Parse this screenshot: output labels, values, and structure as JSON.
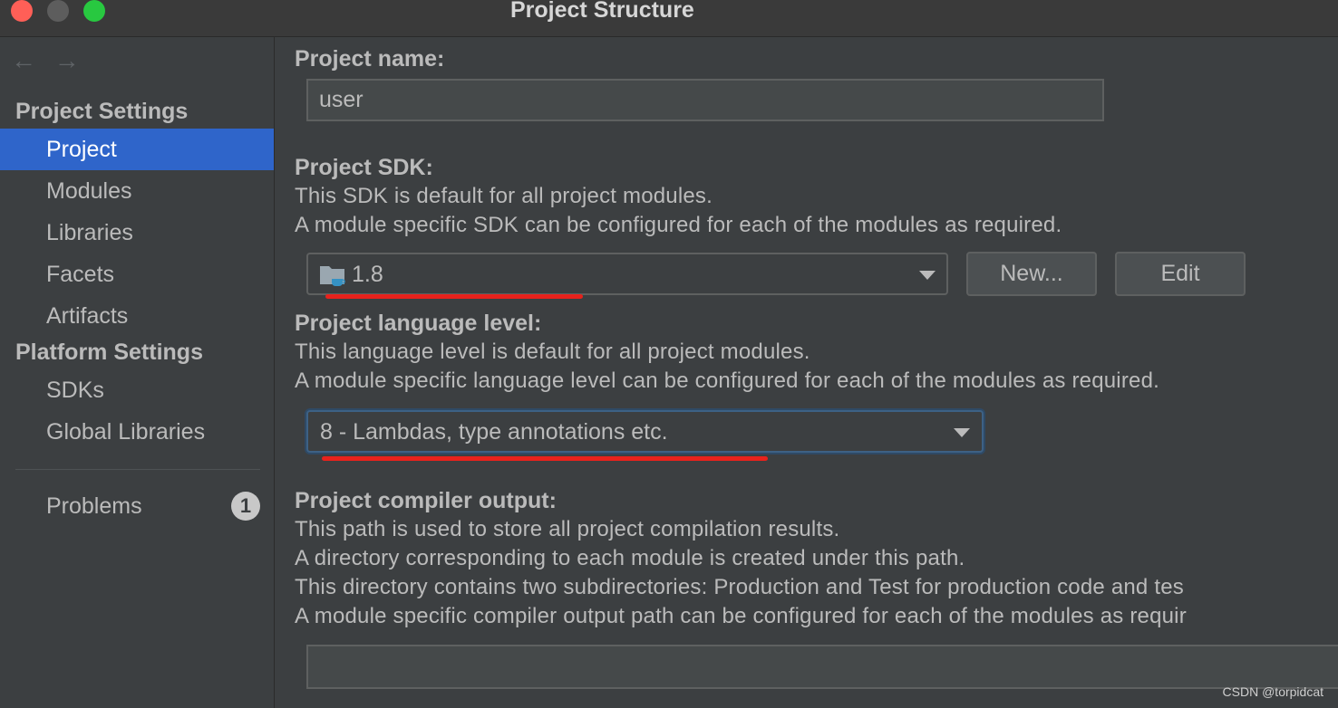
{
  "window": {
    "title": "Project Structure"
  },
  "nav": {
    "back_glyph": "←",
    "forward_glyph": "→"
  },
  "sidebar": {
    "project_settings_header": "Project Settings",
    "project_settings_items": [
      {
        "label": "Project",
        "selected": true
      },
      {
        "label": "Modules"
      },
      {
        "label": "Libraries"
      },
      {
        "label": "Facets"
      },
      {
        "label": "Artifacts"
      }
    ],
    "platform_settings_header": "Platform Settings",
    "platform_settings_items": [
      {
        "label": "SDKs"
      },
      {
        "label": "Global Libraries"
      }
    ],
    "problems": {
      "label": "Problems",
      "count": "1"
    }
  },
  "project_name": {
    "label": "Project name:",
    "value": "user"
  },
  "project_sdk": {
    "label": "Project SDK:",
    "desc_1": "This SDK is default for all project modules.",
    "desc_2": "A module specific SDK can be configured for each of the modules as required.",
    "value": "1.8",
    "new_button": "New...",
    "edit_button": "Edit"
  },
  "language_level": {
    "label": "Project language level:",
    "desc_1": "This language level is default for all project modules.",
    "desc_2": "A module specific language level can be configured for each of the modules as required.",
    "value": "8 - Lambdas, type annotations etc."
  },
  "compiler_output": {
    "label": "Project compiler output:",
    "desc_1": "This path is used to store all project compilation results.",
    "desc_2": "A directory corresponding to each module is created under this path.",
    "desc_3": "This directory contains two subdirectories: Production and Test for production code and tes",
    "desc_4": "A module specific compiler output path can be configured for each of the modules as requir",
    "value": ""
  },
  "watermark": "CSDN @torpidcat",
  "colors": {
    "selection": "#2f65ca",
    "annotation_red": "#e8221c"
  }
}
